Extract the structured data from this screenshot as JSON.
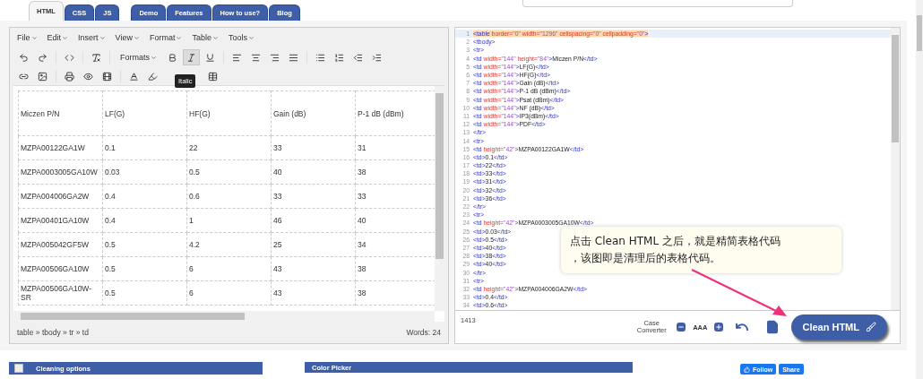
{
  "editor_tabs": [
    {
      "label": "HTML",
      "selected": true
    },
    {
      "label": "CSS",
      "selected": false
    },
    {
      "label": "JS",
      "selected": false
    }
  ],
  "site_tabs": [
    "Demo",
    "Features",
    "How to use?",
    "Blog"
  ],
  "menu": [
    "File",
    "Edit",
    "Insert",
    "View",
    "Format",
    "Table",
    "Tools"
  ],
  "toolbar": {
    "formats_label": "Formats",
    "italic_active": true,
    "tooltip": "Italic"
  },
  "table": {
    "columns": [
      "Miczen P/N",
      "LF(G)",
      "HF(G)",
      "Gain (dB)",
      "P-1 dB (dBm)"
    ],
    "rows": [
      [
        "MZPA00122GA1W",
        "0.1",
        "22",
        "33",
        "31"
      ],
      [
        "MZPA0003005GA10W",
        "0.03",
        "0.5",
        "40",
        "38"
      ],
      [
        "MZPA004006GA2W",
        "0.4",
        "0.6",
        "33",
        "33"
      ],
      [
        "MZPA00401GA10W",
        "0.4",
        "1",
        "46",
        "40"
      ],
      [
        "MZPA005042GF5W",
        "0.5",
        "4.2",
        "25",
        "34"
      ],
      [
        "MZPA00506GA10W",
        "0.5",
        "6",
        "43",
        "38"
      ],
      [
        "MZPA00506GA10W-SR",
        "0.5",
        "6",
        "43",
        "38"
      ]
    ]
  },
  "status": {
    "path": "table » tbody » tr » td",
    "words": "Words: 24"
  },
  "code": [
    {
      "number": "1",
      "highlighted": true,
      "parts": [
        {
          "kind": "tag",
          "text": "<table"
        },
        {
          "kind": "attr",
          "text": " border="
        },
        {
          "kind": "value",
          "text": "\"0\""
        },
        {
          "kind": "attr",
          "text": " width="
        },
        {
          "kind": "value",
          "text": "\"1296\""
        },
        {
          "kind": "attr",
          "text": " cellspacing="
        },
        {
          "kind": "value",
          "text": "\"0\""
        },
        {
          "kind": "attr",
          "text": " cellpadding="
        },
        {
          "kind": "value",
          "text": "\"0\""
        },
        {
          "kind": "tag",
          "text": ">"
        }
      ]
    },
    {
      "number": "2",
      "highlighted": false,
      "parts": [
        {
          "kind": "tag",
          "text": "<tbody>"
        }
      ]
    },
    {
      "number": "3",
      "highlighted": false,
      "parts": [
        {
          "kind": "tag",
          "text": "<tr>"
        }
      ]
    },
    {
      "number": "4",
      "highlighted": false,
      "parts": [
        {
          "kind": "tag",
          "text": "<td"
        },
        {
          "kind": "attr",
          "text": " width="
        },
        {
          "kind": "value",
          "text": "\"144\""
        },
        {
          "kind": "attr",
          "text": " height="
        },
        {
          "kind": "value",
          "text": "\"84\""
        },
        {
          "kind": "tag",
          "text": ">"
        },
        {
          "kind": "text",
          "text": "Miczen P/N"
        },
        {
          "kind": "tag",
          "text": "</td>"
        }
      ]
    },
    {
      "number": "5",
      "highlighted": false,
      "parts": [
        {
          "kind": "tag",
          "text": "<td"
        },
        {
          "kind": "attr",
          "text": " width="
        },
        {
          "kind": "value",
          "text": "\"144\""
        },
        {
          "kind": "tag",
          "text": ">"
        },
        {
          "kind": "text",
          "text": "LF(G)"
        },
        {
          "kind": "tag",
          "text": "</td>"
        }
      ]
    },
    {
      "number": "6",
      "highlighted": false,
      "parts": [
        {
          "kind": "tag",
          "text": "<td"
        },
        {
          "kind": "attr",
          "text": " width="
        },
        {
          "kind": "value",
          "text": "\"144\""
        },
        {
          "kind": "tag",
          "text": ">"
        },
        {
          "kind": "text",
          "text": "HF(G)"
        },
        {
          "kind": "tag",
          "text": "</td>"
        }
      ]
    },
    {
      "number": "7",
      "highlighted": false,
      "parts": [
        {
          "kind": "tag",
          "text": "<td"
        },
        {
          "kind": "attr",
          "text": " width="
        },
        {
          "kind": "value",
          "text": "\"144\""
        },
        {
          "kind": "tag",
          "text": ">"
        },
        {
          "kind": "text",
          "text": "Gain (dB)"
        },
        {
          "kind": "tag",
          "text": "</td>"
        }
      ]
    },
    {
      "number": "8",
      "highlighted": false,
      "parts": [
        {
          "kind": "tag",
          "text": "<td"
        },
        {
          "kind": "attr",
          "text": " width="
        },
        {
          "kind": "value",
          "text": "\"144\""
        },
        {
          "kind": "tag",
          "text": ">"
        },
        {
          "kind": "text",
          "text": "P-1 dB (dBm)"
        },
        {
          "kind": "tag",
          "text": "</td>"
        }
      ]
    },
    {
      "number": "9",
      "highlighted": false,
      "parts": [
        {
          "kind": "tag",
          "text": "<td"
        },
        {
          "kind": "attr",
          "text": " width="
        },
        {
          "kind": "value",
          "text": "\"144\""
        },
        {
          "kind": "tag",
          "text": ">"
        },
        {
          "kind": "text",
          "text": "Psat (dBm)"
        },
        {
          "kind": "tag",
          "text": "</td>"
        }
      ]
    },
    {
      "number": "10",
      "highlighted": false,
      "parts": [
        {
          "kind": "tag",
          "text": "<td"
        },
        {
          "kind": "attr",
          "text": " width="
        },
        {
          "kind": "value",
          "text": "\"144\""
        },
        {
          "kind": "tag",
          "text": ">"
        },
        {
          "kind": "text",
          "text": "NF (dB)"
        },
        {
          "kind": "tag",
          "text": "</td>"
        }
      ]
    },
    {
      "number": "11",
      "highlighted": false,
      "parts": [
        {
          "kind": "tag",
          "text": "<td"
        },
        {
          "kind": "attr",
          "text": " width="
        },
        {
          "kind": "value",
          "text": "\"144\""
        },
        {
          "kind": "tag",
          "text": ">"
        },
        {
          "kind": "text",
          "text": "IP3(dBm)"
        },
        {
          "kind": "tag",
          "text": "</td>"
        }
      ]
    },
    {
      "number": "12",
      "highlighted": false,
      "parts": [
        {
          "kind": "tag",
          "text": "<td"
        },
        {
          "kind": "attr",
          "text": " width="
        },
        {
          "kind": "value",
          "text": "\"144\""
        },
        {
          "kind": "tag",
          "text": ">"
        },
        {
          "kind": "text",
          "text": "PDF"
        },
        {
          "kind": "tag",
          "text": "</td>"
        }
      ]
    },
    {
      "number": "13",
      "highlighted": false,
      "parts": [
        {
          "kind": "tag",
          "text": "</tr>"
        }
      ]
    },
    {
      "number": "14",
      "highlighted": false,
      "parts": [
        {
          "kind": "tag",
          "text": "<tr>"
        }
      ]
    },
    {
      "number": "15",
      "highlighted": false,
      "parts": [
        {
          "kind": "tag",
          "text": "<td"
        },
        {
          "kind": "attr",
          "text": " height="
        },
        {
          "kind": "value",
          "text": "\"42\""
        },
        {
          "kind": "tag",
          "text": ">"
        },
        {
          "kind": "text",
          "text": "MZPA00122GA1W"
        },
        {
          "kind": "tag",
          "text": "</td>"
        }
      ]
    },
    {
      "number": "16",
      "highlighted": false,
      "parts": [
        {
          "kind": "tag",
          "text": "<td>"
        },
        {
          "kind": "text",
          "text": "0.1"
        },
        {
          "kind": "tag",
          "text": "</td>"
        }
      ]
    },
    {
      "number": "17",
      "highlighted": false,
      "parts": [
        {
          "kind": "tag",
          "text": "<td>"
        },
        {
          "kind": "text",
          "text": "22"
        },
        {
          "kind": "tag",
          "text": "</td>"
        }
      ]
    },
    {
      "number": "18",
      "highlighted": false,
      "parts": [
        {
          "kind": "tag",
          "text": "<td>"
        },
        {
          "kind": "text",
          "text": "33"
        },
        {
          "kind": "tag",
          "text": "</td>"
        }
      ]
    },
    {
      "number": "19",
      "highlighted": false,
      "parts": [
        {
          "kind": "tag",
          "text": "<td>"
        },
        {
          "kind": "text",
          "text": "31"
        },
        {
          "kind": "tag",
          "text": "</td>"
        }
      ]
    },
    {
      "number": "20",
      "highlighted": false,
      "parts": [
        {
          "kind": "tag",
          "text": "<td>"
        },
        {
          "kind": "text",
          "text": "32"
        },
        {
          "kind": "tag",
          "text": "</td>"
        }
      ]
    },
    {
      "number": "21",
      "highlighted": false,
      "parts": [
        {
          "kind": "tag",
          "text": "<td>"
        },
        {
          "kind": "text",
          "text": "36"
        },
        {
          "kind": "tag",
          "text": "</td>"
        }
      ]
    },
    {
      "number": "22",
      "highlighted": false,
      "parts": [
        {
          "kind": "tag",
          "text": "</tr>"
        }
      ]
    },
    {
      "number": "23",
      "highlighted": false,
      "parts": [
        {
          "kind": "tag",
          "text": "<tr>"
        }
      ]
    },
    {
      "number": "24",
      "highlighted": false,
      "parts": [
        {
          "kind": "tag",
          "text": "<td"
        },
        {
          "kind": "attr",
          "text": " height="
        },
        {
          "kind": "value",
          "text": "\"42\""
        },
        {
          "kind": "tag",
          "text": ">"
        },
        {
          "kind": "text",
          "text": "MZPA0003005GA10W"
        },
        {
          "kind": "tag",
          "text": "</td>"
        }
      ]
    },
    {
      "number": "25",
      "highlighted": false,
      "parts": [
        {
          "kind": "tag",
          "text": "<td>"
        },
        {
          "kind": "text",
          "text": "0.03"
        },
        {
          "kind": "tag",
          "text": "</td>"
        }
      ]
    },
    {
      "number": "26",
      "highlighted": false,
      "parts": [
        {
          "kind": "tag",
          "text": "<td>"
        },
        {
          "kind": "text",
          "text": "0.5"
        },
        {
          "kind": "tag",
          "text": "</td>"
        }
      ]
    },
    {
      "number": "27",
      "highlighted": false,
      "parts": [
        {
          "kind": "tag",
          "text": "<td>"
        },
        {
          "kind": "text",
          "text": "40"
        },
        {
          "kind": "tag",
          "text": "</td>"
        }
      ]
    },
    {
      "number": "28",
      "highlighted": false,
      "parts": [
        {
          "kind": "tag",
          "text": "<td>"
        },
        {
          "kind": "text",
          "text": "38"
        },
        {
          "kind": "tag",
          "text": "</td>"
        }
      ]
    },
    {
      "number": "29",
      "highlighted": false,
      "parts": [
        {
          "kind": "tag",
          "text": "<td>"
        },
        {
          "kind": "text",
          "text": "40"
        },
        {
          "kind": "tag",
          "text": "</td>"
        }
      ]
    },
    {
      "number": "30",
      "highlighted": false,
      "parts": [
        {
          "kind": "tag",
          "text": "</tr>"
        }
      ]
    },
    {
      "number": "31",
      "highlighted": false,
      "parts": [
        {
          "kind": "tag",
          "text": "<tr>"
        }
      ]
    },
    {
      "number": "32",
      "highlighted": false,
      "parts": [
        {
          "kind": "tag",
          "text": "<td"
        },
        {
          "kind": "attr",
          "text": " height="
        },
        {
          "kind": "value",
          "text": "\"42\""
        },
        {
          "kind": "tag",
          "text": ">"
        },
        {
          "kind": "text",
          "text": "MZPA004006GA2W"
        },
        {
          "kind": "tag",
          "text": "</td>"
        }
      ]
    },
    {
      "number": "33",
      "highlighted": false,
      "parts": [
        {
          "kind": "tag",
          "text": "<td>"
        },
        {
          "kind": "text",
          "text": "0.4"
        },
        {
          "kind": "tag",
          "text": "</td>"
        }
      ]
    },
    {
      "number": "34",
      "highlighted": false,
      "parts": [
        {
          "kind": "tag",
          "text": "<td>"
        },
        {
          "kind": "text",
          "text": "0.6"
        },
        {
          "kind": "tag",
          "text": "</td>"
        }
      ]
    }
  ],
  "callout": [
    "点击 Clean HTML 之后，就是精简表格代码",
    "，该图即是清理后的表格代码。"
  ],
  "footer": {
    "count": "1413",
    "case_converter": "Case Converter",
    "case_sample": "AAA",
    "clean_button": "Clean HTML"
  },
  "cleaning_options": {
    "title": "Cleaning options",
    "checked": false
  },
  "color_picker": {
    "title": "Color Picker"
  },
  "social": [
    "Follow",
    "Share"
  ]
}
